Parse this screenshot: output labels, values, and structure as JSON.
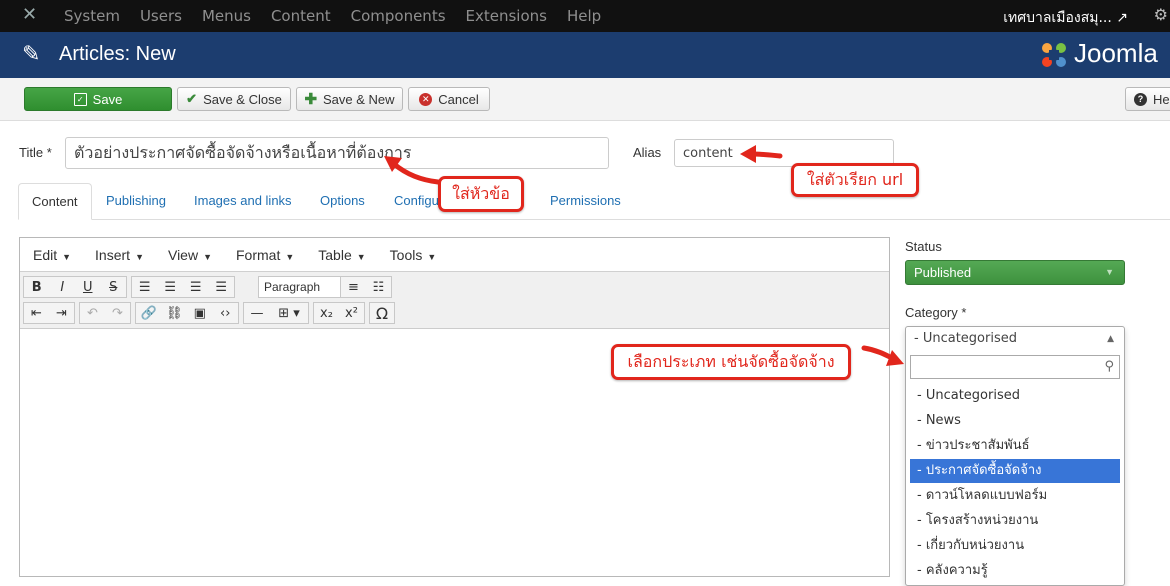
{
  "topbar": {
    "menu": [
      "System",
      "Users",
      "Menus",
      "Content",
      "Components",
      "Extensions",
      "Help"
    ],
    "site_name": "เทศบาลเมืองสมุ... ↗"
  },
  "header": {
    "page_title": "Articles: New",
    "brand": "Joomla"
  },
  "toolbar": {
    "save": "Save",
    "save_close": "Save & Close",
    "save_new": "Save & New",
    "cancel": "Cancel",
    "help": "He"
  },
  "form": {
    "title_label": "Title *",
    "title_value": "ตัวอย่างประกาศจัดซื้อจัดจ้างหรือเนื้อหาที่ต้องการ",
    "alias_label": "Alias",
    "alias_value": "content"
  },
  "tabs": [
    "Content",
    "Publishing",
    "Images and links",
    "Options",
    "Configu",
    "Permissions"
  ],
  "editor": {
    "menu": [
      "Edit",
      "Insert",
      "View",
      "Format",
      "Table",
      "Tools"
    ],
    "format_select": "Paragraph"
  },
  "sidebar": {
    "status_label": "Status",
    "status_value": "Published",
    "category_label": "Category *",
    "category_value": "- Uncategorised",
    "category_options": [
      "- Uncategorised",
      "- News",
      "- ข่าวประชาสัมพันธ์",
      "- ประกาศจัดซื้อจัดจ้าง",
      "- ดาวน์โหลดแบบฟอร์ม",
      "- โครงสร้างหน่วยงาน",
      "- เกี่ยวกับหน่วยงาน",
      "- คลังความรู้"
    ],
    "selected_index": 3
  },
  "annotations": {
    "title_hint": "ใส่หัวข้อ",
    "alias_hint": "ใส่ตัวเรียก url",
    "category_hint": "เลือกประเภท เช่นจัดซื้อจัดจ้าง"
  },
  "colors": {
    "header_bg": "#1c3d6f",
    "save_green": "#3e913e",
    "callout_red": "#e1261c",
    "selection_blue": "#3875d7"
  }
}
